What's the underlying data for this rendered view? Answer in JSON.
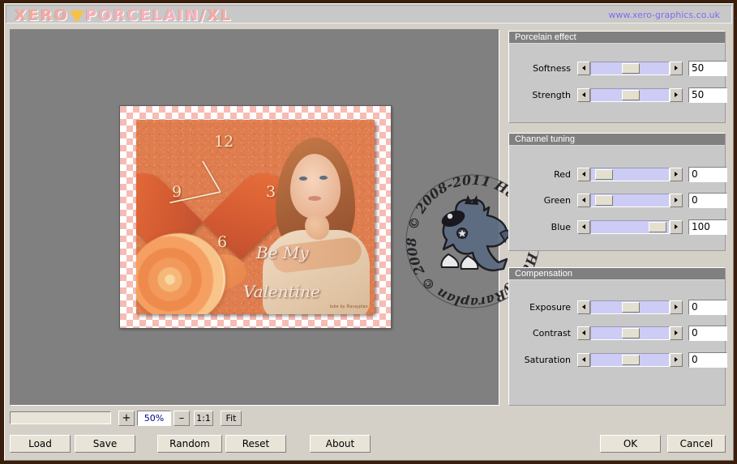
{
  "window": {
    "brand_part1": "XERO",
    "brand_part2": "PORCELAIN",
    "brand_part3": "/XL",
    "site_url": "www.xero-graphics.co.uk"
  },
  "preview": {
    "artwork_caption_line1": "Be My",
    "artwork_caption_line2": "Valentine",
    "clock_numbers": {
      "twelve": "12",
      "three": "3",
      "six": "6",
      "nine": "9"
    },
    "artist_signature": "tube by Rarayplan"
  },
  "watermark": {
    "top_text": "© 2008-2011  HappyRaraplan",
    "bottom_text": "HappyRaraplan  ©  2008-2011"
  },
  "panels": [
    {
      "title": "Porcelain effect",
      "controls": [
        {
          "label": "Softness",
          "value": "50",
          "thumb_percent": 50
        },
        {
          "label": "Strength",
          "value": "50",
          "thumb_percent": 50
        }
      ]
    },
    {
      "title": "Channel tuning",
      "controls": [
        {
          "label": "Red",
          "value": "0",
          "thumb_percent": 6
        },
        {
          "label": "Green",
          "value": "0",
          "thumb_percent": 6
        },
        {
          "label": "Blue",
          "value": "100",
          "thumb_percent": 94
        }
      ]
    },
    {
      "title": "Compensation",
      "controls": [
        {
          "label": "Exposure",
          "value": "0",
          "thumb_percent": 50
        },
        {
          "label": "Contrast",
          "value": "0",
          "thumb_percent": 50
        },
        {
          "label": "Saturation",
          "value": "0",
          "thumb_percent": 50
        }
      ]
    }
  ],
  "zoombar": {
    "status_text": "",
    "zoom_in_label": "+",
    "zoom_value": "50%",
    "zoom_out_label": "–",
    "one_to_one_label": "1:1",
    "fit_label": "Fit"
  },
  "buttons": {
    "load": "Load",
    "save": "Save",
    "random": "Random",
    "reset": "Reset",
    "about": "About",
    "ok": "OK",
    "cancel": "Cancel"
  },
  "colors": {
    "window_face": "#d4d0c8",
    "panel_face": "#c8c8c8",
    "panel_header": "#808080",
    "slider_track": "#ccccf4",
    "slider_thumb": "#e4e0d0",
    "canvas_bg": "#808080",
    "brand_pink": "#f6aaa2",
    "brand_triangle": "#f5c243",
    "url_blue": "#7b6ef0",
    "outer_border": "#3a1e0c"
  }
}
